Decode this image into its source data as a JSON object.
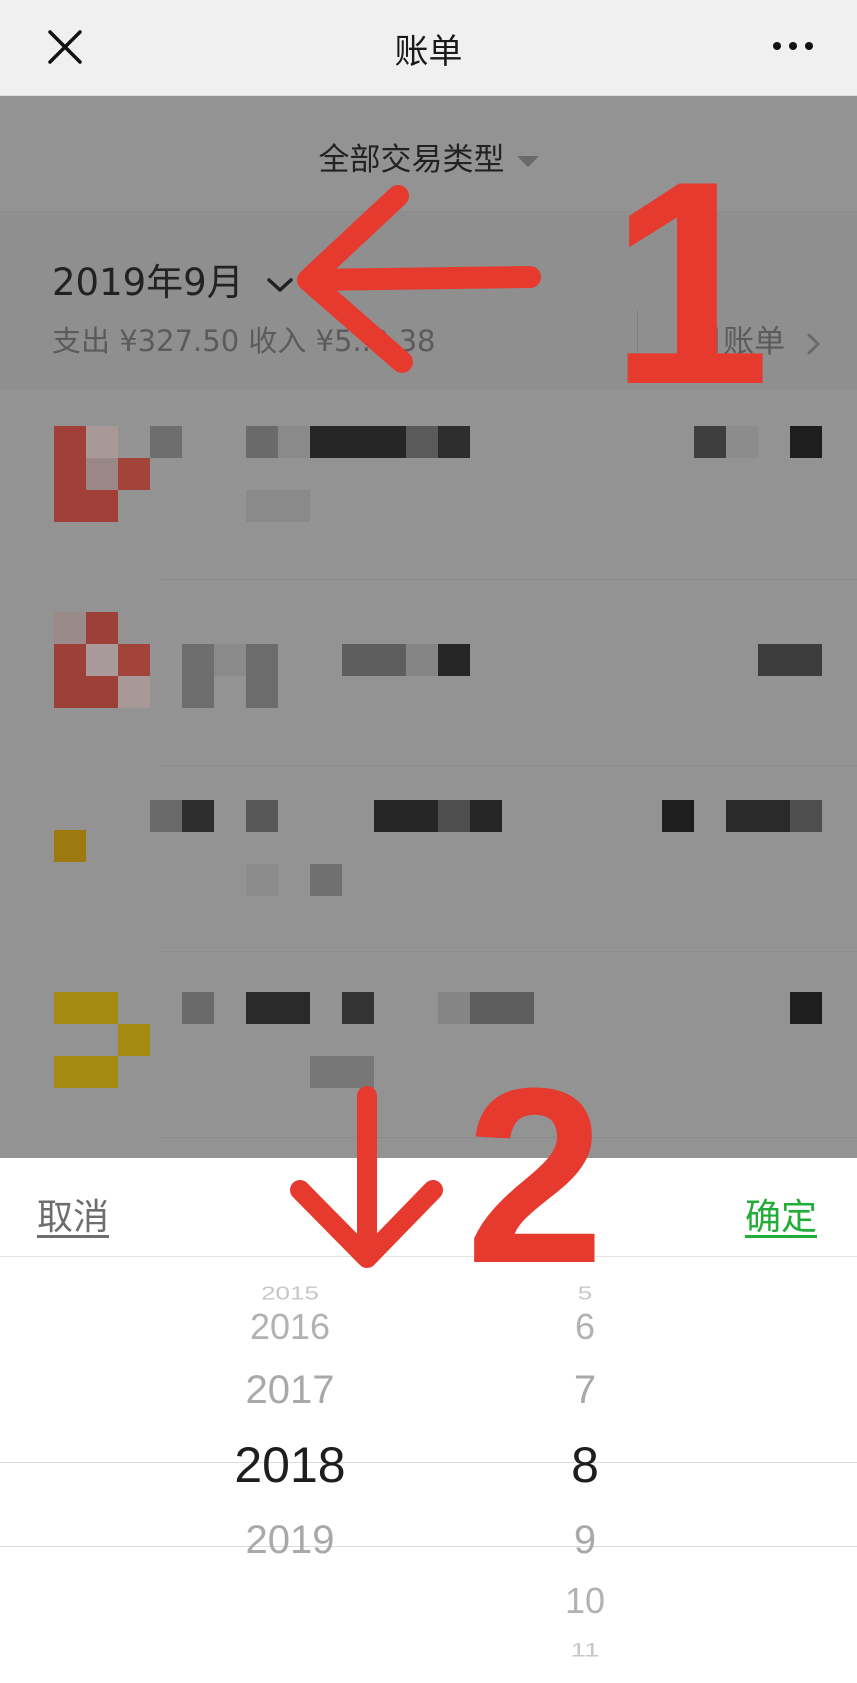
{
  "navbar": {
    "title": "账单",
    "close_icon": "close-icon",
    "more_icon": "more-dots-icon"
  },
  "filter": {
    "label": "全部交易类型",
    "caret_icon": "caret-down-icon"
  },
  "month": {
    "title": "2019年9月",
    "chevron_icon": "chevron-down-icon",
    "summary": "支出 ¥327.50 收入 ¥5..9.38",
    "bill_link": "月账单",
    "bill_link_icon": "chevron-right-icon"
  },
  "picker": {
    "cancel_label": "取消",
    "confirm_label": "确定",
    "years": [
      "2015",
      "2016",
      "2017",
      "2018",
      "2019"
    ],
    "months": [
      "5",
      "6",
      "7",
      "8",
      "9",
      "10",
      "11"
    ],
    "selected_year": "2018",
    "selected_month": "8"
  },
  "annotations": {
    "arrow1_label": "1",
    "arrow2_label": "2",
    "color": "#e63a2e"
  },
  "colors": {
    "accent_green": "#22ad38",
    "overlay_gray": "#939393",
    "navbar_bg": "#f0f0f0"
  }
}
